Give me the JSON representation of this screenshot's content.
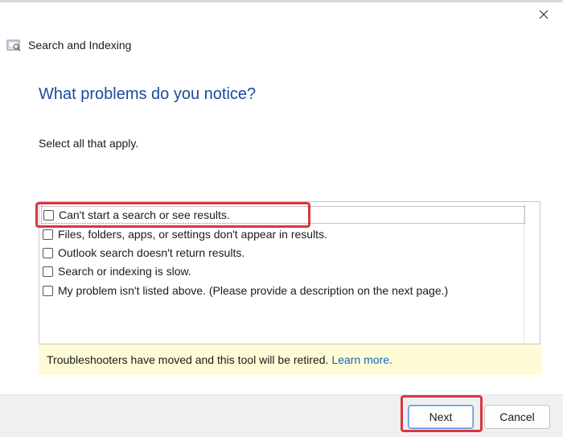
{
  "window": {
    "title": "Search and Indexing",
    "close_icon": "close-icon",
    "app_icon": "search-indexing-icon"
  },
  "main": {
    "heading": "What problems do you notice?",
    "instruction": "Select all that apply.",
    "options": [
      {
        "label": "Can't start a search or see results.",
        "checked": false
      },
      {
        "label": "Files, folders, apps, or settings don't appear in results.",
        "checked": false
      },
      {
        "label": "Outlook search doesn't return results.",
        "checked": false
      },
      {
        "label": "Search or indexing is slow.",
        "checked": false
      },
      {
        "label": "My problem isn't listed above. (Please provide a description on the next page.)",
        "checked": false
      }
    ],
    "banner": {
      "text": "Troubleshooters have moved and this tool will be retired.",
      "link": "Learn more."
    }
  },
  "footer": {
    "next_label": "Next",
    "cancel_label": "Cancel"
  },
  "colors": {
    "heading": "#1a4b9a",
    "link": "#1565c0",
    "banner_bg": "#fffbd6",
    "highlight": "#d9363e"
  }
}
